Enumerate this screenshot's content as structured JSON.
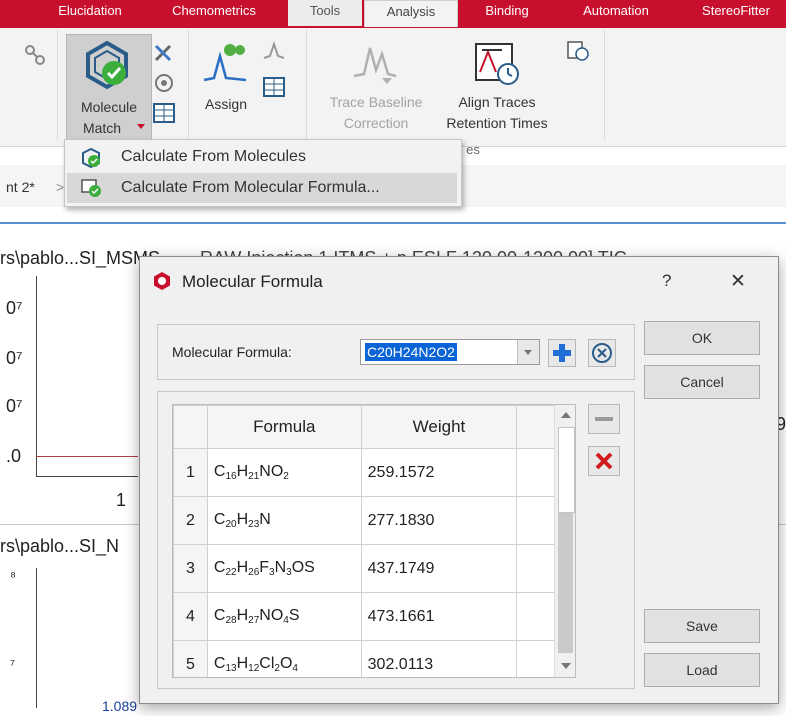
{
  "ribbon": {
    "tabs": [
      "Elucidation",
      "Chemometrics",
      "Tools",
      "Analysis",
      "Binding",
      "Automation",
      "StereoFitter"
    ],
    "active_tab": "Analysis",
    "molecule_match_label": [
      "Molecule",
      "Match"
    ],
    "assign_label": "Assign",
    "trace_baseline_label": [
      "Trace Baseline",
      "Correction"
    ],
    "align_traces_label": [
      "Align Traces",
      "Retention Times"
    ],
    "group_fragment": "es"
  },
  "menu": {
    "items": [
      {
        "label": "Calculate From Molecules",
        "icon": "molecule-check-icon"
      },
      {
        "label": "Calculate From Molecular Formula...",
        "icon": "formula-check-icon"
      }
    ]
  },
  "background": {
    "breadcrumb": "nt 2*",
    "breadcrumb_sep": ">",
    "panel1_path": "rs\\pablo...SI_MSMS",
    "panel1_header_rest": "RAW   Injection 1   ITMS + p ESI F   120.00-1200.00]   TIC",
    "panel2_path": "rs\\pablo...SI_N",
    "axis_labels": [
      "0⁷",
      "0⁷",
      "0⁷",
      ".0",
      "1",
      "⁸",
      "⁷"
    ],
    "peak_value": "1.089",
    "side_digit": "9"
  },
  "dialog": {
    "title": "Molecular Formula",
    "help": "?",
    "close": "✕",
    "formula_label": "Molecular Formula:",
    "formula_value": "C20H24N2O2",
    "ok_label": "OK",
    "cancel_label": "Cancel",
    "save_label": "Save",
    "load_label": "Load",
    "table": {
      "headers": [
        "Formula",
        "Weight"
      ],
      "rows": [
        {
          "index": "1",
          "formula": "C16H21NO2",
          "weight": "259.1572"
        },
        {
          "index": "2",
          "formula": "C20H23N",
          "weight": "277.1830"
        },
        {
          "index": "3",
          "formula": "C22H26F3N3OS",
          "weight": "437.1749"
        },
        {
          "index": "4",
          "formula": "C28H27NO4S",
          "weight": "473.1661"
        },
        {
          "index": "5",
          "formula": "C13H12Cl2O4",
          "weight": "302.0113"
        }
      ]
    }
  },
  "colors": {
    "ribbon_red": "#c8102e",
    "selection_blue": "#0a64d6",
    "remove_red": "#d01c1c",
    "add_blue": "#1f6fd6"
  }
}
